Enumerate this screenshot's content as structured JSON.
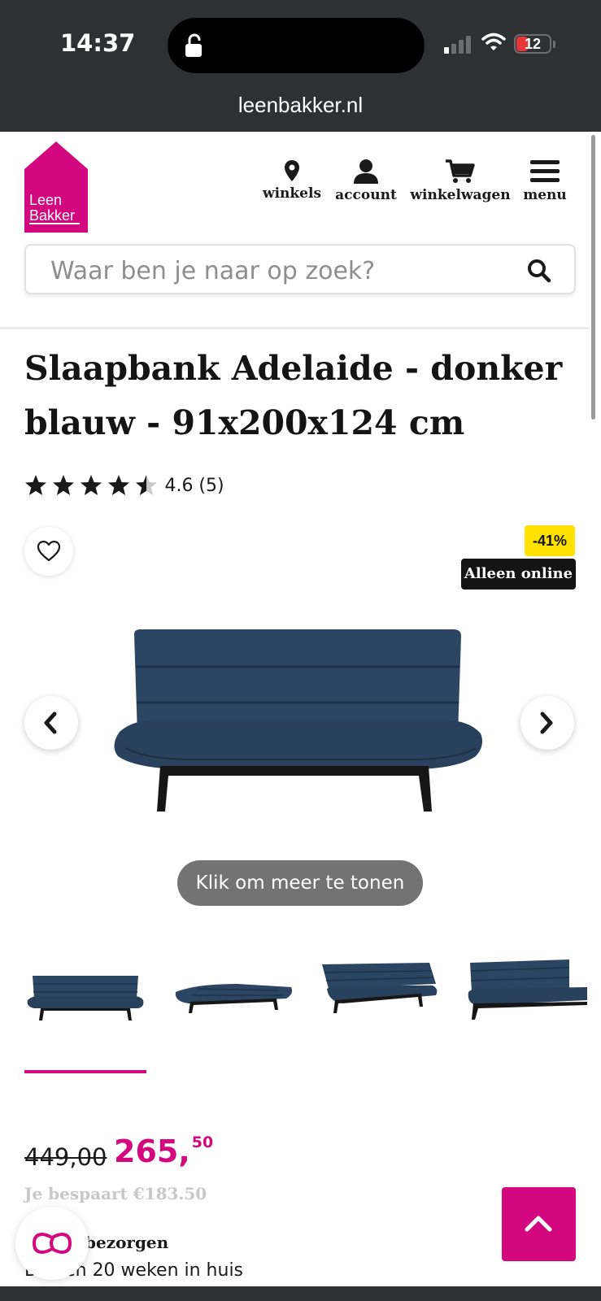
{
  "status_bar": {
    "time": "14:37",
    "battery": "12"
  },
  "browser": {
    "url": "leenbakker.nl"
  },
  "logo": {
    "line1": "Leen",
    "line2": "Bakker",
    "color": "#d3087e"
  },
  "nav": {
    "winkels": "winkels",
    "account": "account",
    "winkelwagen": "winkelwagen",
    "menu": "menu"
  },
  "search": {
    "placeholder": "Waar ben je naar op zoek?"
  },
  "product": {
    "title": "Slaapbank Adelaide - donker blauw - 91x200x124 cm",
    "rating_stars": 4.5,
    "rating_text": "4.6 (5)",
    "badge_discount": "-41%",
    "badge_online": "Alleen online",
    "more_button": "Klik om meer te tonen",
    "thumbnail_count": 4
  },
  "price": {
    "old": "449,00",
    "new_main": "265,",
    "new_cents": "50",
    "savings": "Je bespaart €183.50",
    "delivery_title": "bezorgen",
    "delivery_sub": "Binnen 20 weken in huis"
  },
  "colors": {
    "accent": "#d3087e",
    "badge_yellow": "#ffe100",
    "sofa": "#2c4562"
  }
}
